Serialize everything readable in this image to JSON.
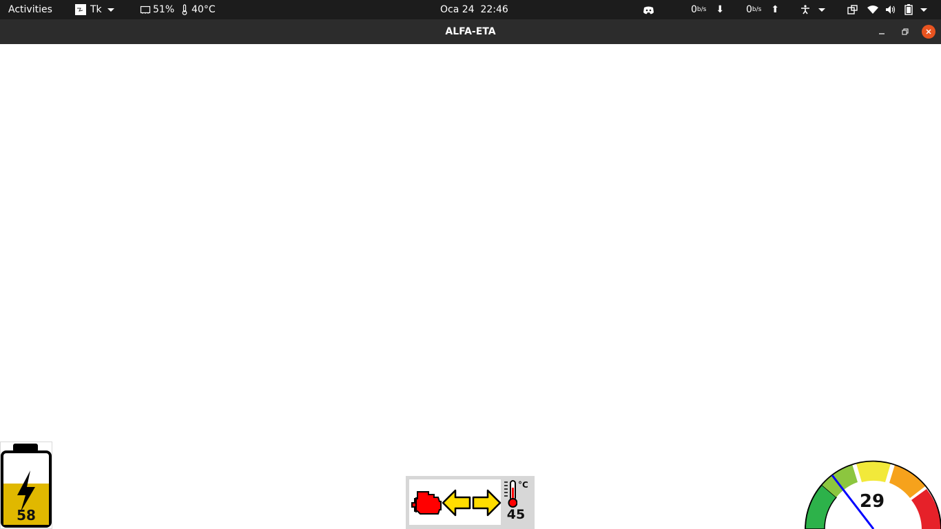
{
  "topbar": {
    "activities": "Activities",
    "app_menu": "Tk",
    "cpu": "51%",
    "temperature": "40°C",
    "datetime": "Oca 24  22:46",
    "net_down_value": "0",
    "net_down_unit": "b/s",
    "net_up_value": "0",
    "net_up_unit": "b/s"
  },
  "window": {
    "title": "ALFA-ETA"
  },
  "dashboard": {
    "battery_level": 58,
    "battery_label": "58",
    "engine_temperature": "45",
    "temperature_unit": "°C",
    "speed": "29"
  },
  "colors": {
    "battery_fill": "#e0b800",
    "engine_icon": "#ff0000",
    "arrow": "#ffdd00",
    "gauge_green": "#2db24a",
    "gauge_light_green": "#8cc63f",
    "gauge_yellow": "#f2e93a",
    "gauge_orange": "#f6a21c",
    "gauge_red": "#e62129",
    "needle": "#0000ff"
  }
}
